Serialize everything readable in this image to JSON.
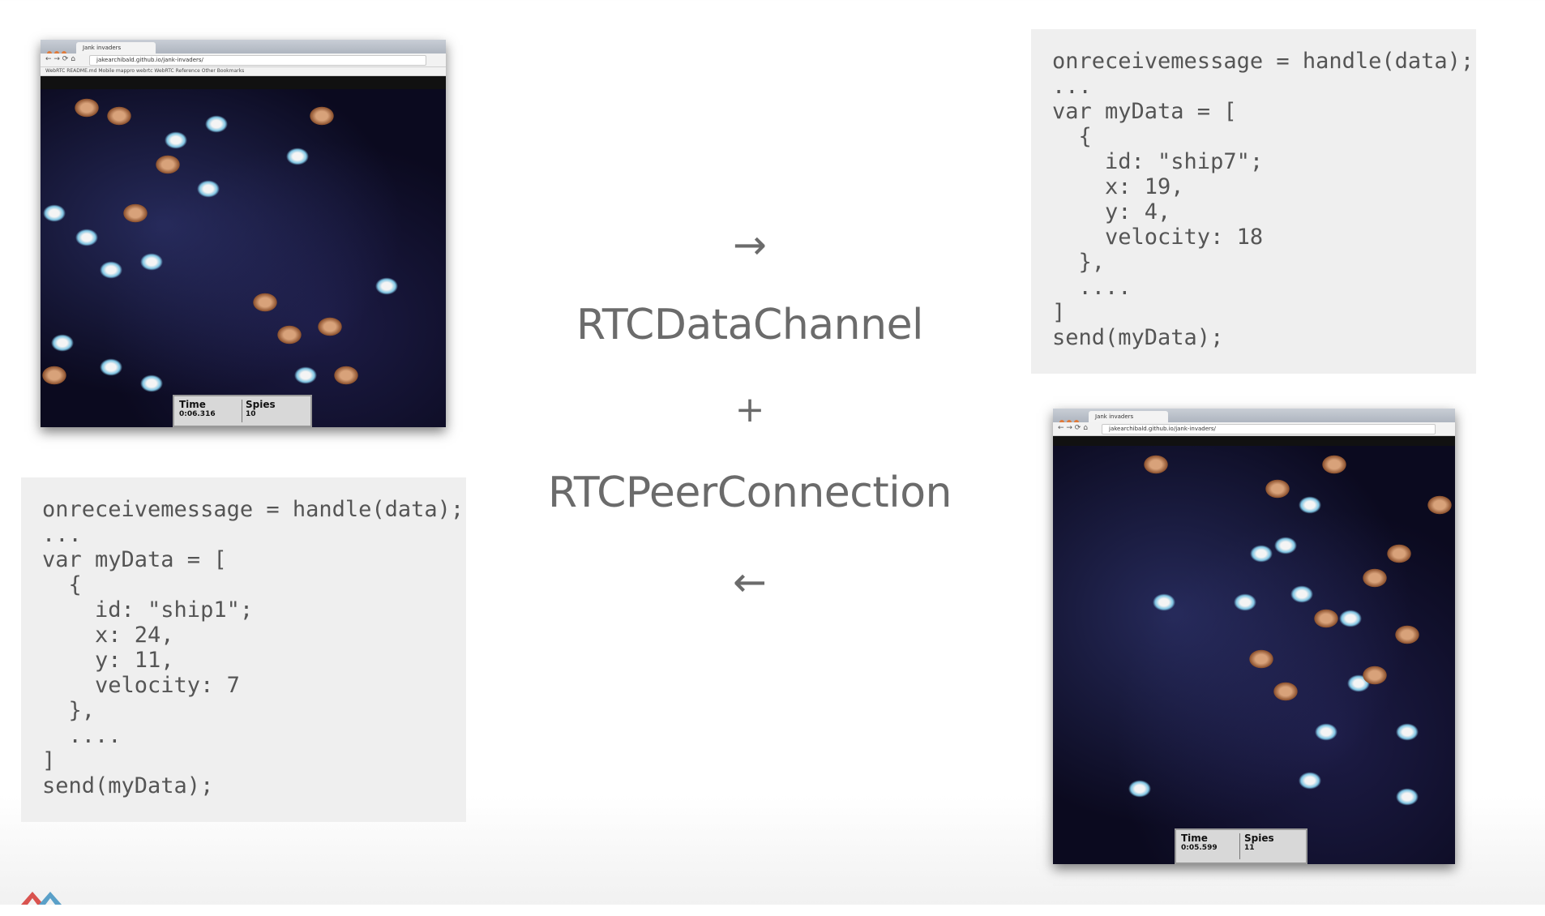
{
  "left_window": {
    "tab_title": "Jank invaders",
    "url": "jakearchibald.github.io/jank-invaders/",
    "bookmarks": "WebRTC   README.md   Mobile   mappro   webrtc   WebRTC Reference   Other Bookmarks",
    "hud": {
      "time_label": "Time",
      "time_value": "0:06.316",
      "spies_label": "Spies",
      "spies_value": "10"
    }
  },
  "right_window": {
    "tab_title": "Jank invaders",
    "url": "jakearchibald.github.io/jank-invaders/",
    "hud": {
      "time_label": "Time",
      "time_value": "0:05.599",
      "spies_label": "Spies",
      "spies_value": "11"
    }
  },
  "code_left": "onreceivemessage = handle(data);\n...\nvar myData = [\n  {\n    id: \"ship1\";\n    x: 24,\n    y: 11,\n    velocity: 7\n  },\n  ....\n]\nsend(myData);",
  "code_right": "onreceivemessage = handle(data);\n...\nvar myData = [\n  {\n    id: \"ship7\";\n    x: 19,\n    y: 4,\n    velocity: 18\n  },\n  ....\n]\nsend(myData);",
  "center": {
    "arrow_right": "→",
    "label_datachannel": "RTCDataChannel",
    "plus": "+",
    "label_peerconnection": "RTCPeerConnection",
    "arrow_left": "←"
  }
}
